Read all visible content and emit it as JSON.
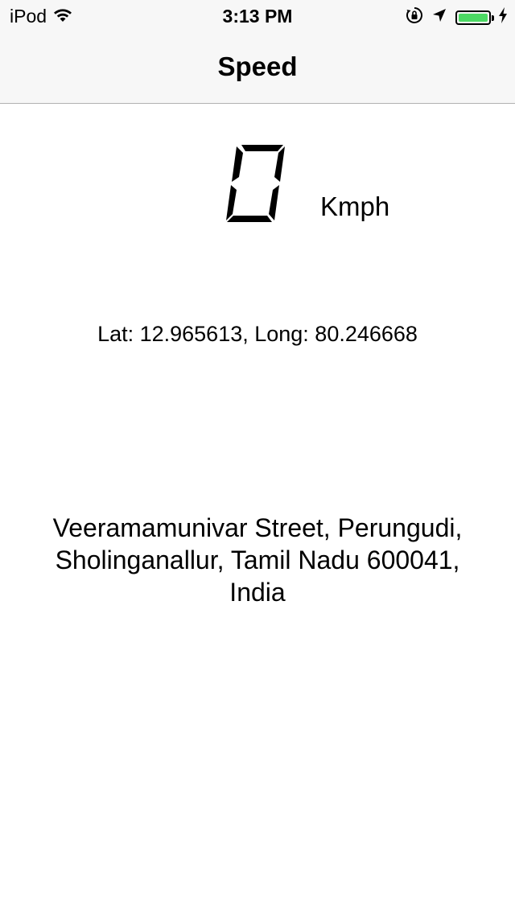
{
  "status_bar": {
    "carrier": "iPod",
    "time": "3:13 PM",
    "battery_color": "#4cd964",
    "icons": [
      "wifi-icon",
      "orientation-lock-icon",
      "location-arrow-icon",
      "battery-icon",
      "charging-bolt-icon"
    ]
  },
  "nav": {
    "title": "Speed"
  },
  "speed": {
    "value": "0",
    "unit": "Kmph"
  },
  "location": {
    "coords_text": "Lat: 12.965613, Long: 80.246668",
    "address_line1": "Veeramamunivar Street, Perungudi,",
    "address_line2": "Sholinganallur, Tamil Nadu 600041,",
    "address_line3": "India"
  }
}
